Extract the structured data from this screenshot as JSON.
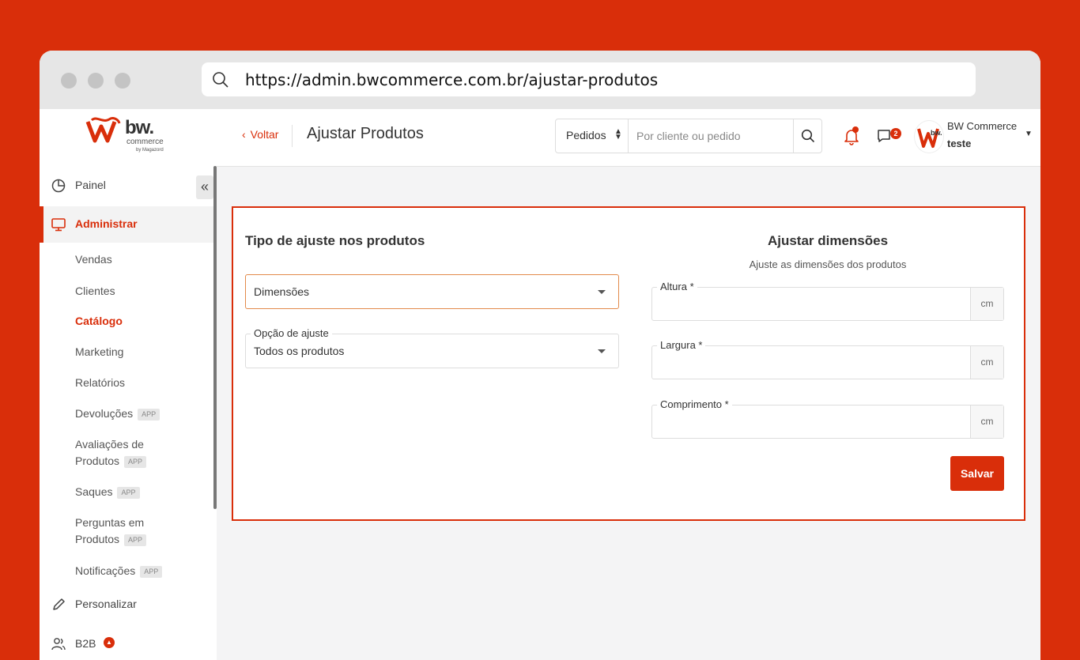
{
  "browser": {
    "url": "https://admin.bwcommerce.com.br/ajustar-produtos"
  },
  "logo": {
    "name": "bw.",
    "commerce": "commerce",
    "by": "by Magazord"
  },
  "sidebar": {
    "collapse_glyph": "«",
    "items": [
      {
        "label": "Painel",
        "icon": "pie-chart-icon"
      },
      {
        "label": "Administrar",
        "icon": "monitor-icon"
      },
      {
        "label": "Personalizar",
        "icon": "pencil-icon"
      },
      {
        "label": "B2B",
        "icon": "users-icon",
        "badge_icon": "flame-icon"
      }
    ],
    "sub_items": [
      {
        "label": "Vendas"
      },
      {
        "label": "Clientes"
      },
      {
        "label": "Catálogo"
      },
      {
        "label": "Marketing"
      },
      {
        "label": "Relatórios"
      },
      {
        "label": "Devoluções",
        "badge": "APP"
      },
      {
        "label_line1": "Avaliações de",
        "label_line2": "Produtos",
        "badge": "APP"
      },
      {
        "label": "Saques",
        "badge": "APP"
      },
      {
        "label_line1": "Perguntas em",
        "label_line2": "Produtos",
        "badge": "APP"
      },
      {
        "label": "Notificações",
        "badge": "APP"
      }
    ]
  },
  "topbar": {
    "back_label": "Voltar",
    "title": "Ajustar Produtos",
    "search_type": "Pedidos",
    "search_placeholder": "Por cliente ou pedido",
    "chat_count": "2",
    "user_name": "BW Commerce",
    "user_sub": "teste"
  },
  "form": {
    "left_title": "Tipo de ajuste nos produtos",
    "adjust_type_value": "Dimensões",
    "adjust_option_label": "Opção de ajuste",
    "adjust_option_value": "Todos os produtos",
    "right_title": "Ajustar dimensões",
    "right_subtitle": "Ajuste as dimensões dos produtos",
    "fields": [
      {
        "label": "Altura *",
        "unit": "cm",
        "value": ""
      },
      {
        "label": "Largura *",
        "unit": "cm",
        "value": ""
      },
      {
        "label": "Comprimento *",
        "unit": "cm",
        "value": ""
      }
    ],
    "save_label": "Salvar"
  },
  "colors": {
    "brand": "#d92e0a",
    "focus_border": "#e28a4b"
  }
}
